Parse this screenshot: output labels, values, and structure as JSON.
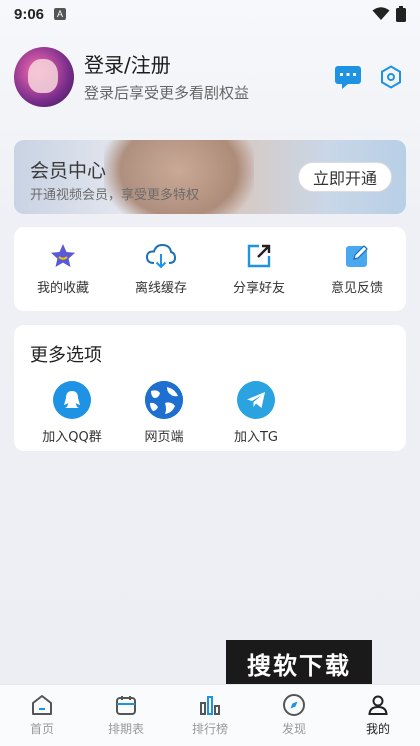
{
  "status_bar": {
    "time": "9:06",
    "notif": "A"
  },
  "profile": {
    "title": "登录/注册",
    "subtitle": "登录后享受更多看剧权益"
  },
  "banner": {
    "title": "会员中心",
    "subtitle": "开通视频会员，享受更多特权",
    "button": "立即开通"
  },
  "actions": [
    {
      "label": "我的收藏",
      "icon": "star-icon"
    },
    {
      "label": "离线缓存",
      "icon": "cloud-download-icon"
    },
    {
      "label": "分享好友",
      "icon": "share-icon"
    },
    {
      "label": "意见反馈",
      "icon": "feedback-icon"
    }
  ],
  "more": {
    "title": "更多选项",
    "items": [
      {
        "label": "加入QQ群",
        "icon": "qq-icon"
      },
      {
        "label": "网页端",
        "icon": "globe-icon"
      },
      {
        "label": "加入TG",
        "icon": "telegram-icon"
      }
    ]
  },
  "watermark": "搜软下载",
  "tabs": [
    {
      "label": "首页",
      "icon": "home-icon"
    },
    {
      "label": "排期表",
      "icon": "calendar-icon"
    },
    {
      "label": "排行榜",
      "icon": "ranking-icon"
    },
    {
      "label": "发现",
      "icon": "compass-icon"
    },
    {
      "label": "我的",
      "icon": "user-icon",
      "active": true
    }
  ],
  "colors": {
    "accent": "#1e93e3",
    "active_tab": "#222222",
    "inactive_tab": "#999999"
  }
}
